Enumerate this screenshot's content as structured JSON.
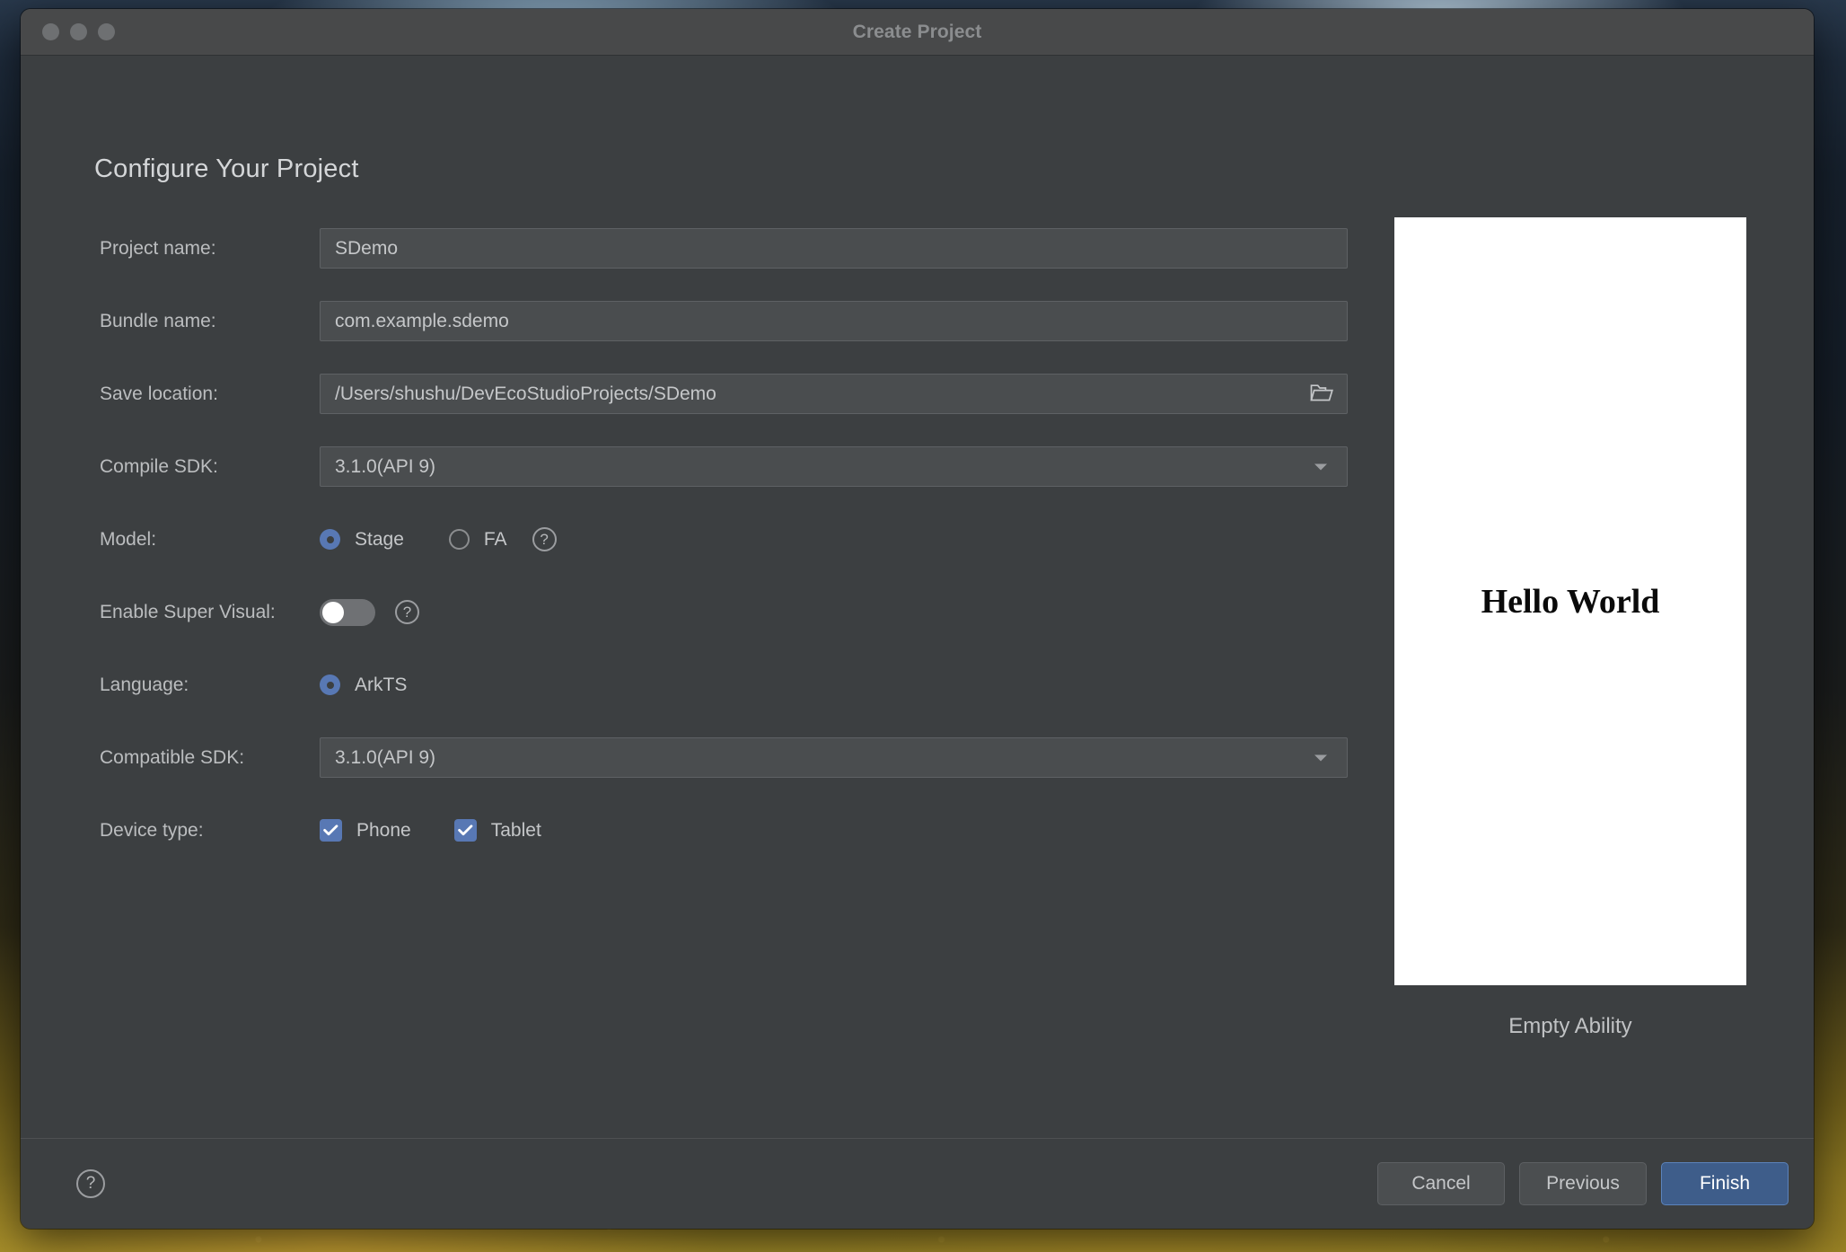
{
  "window": {
    "title": "Create Project",
    "traffic_lights": [
      "close-button",
      "minimize-button",
      "maximize-button"
    ]
  },
  "heading": "Configure Your Project",
  "form": {
    "fields": [
      {
        "type": "text",
        "name": "project-name",
        "label": "Project name:",
        "value": "SDemo",
        "placeholder": "Project name"
      },
      {
        "type": "text",
        "name": "bundle-name",
        "label": "Bundle name:",
        "value": "com.example.sdemo",
        "placeholder": "Bundle name"
      },
      {
        "type": "text-with-browse",
        "name": "save-location",
        "label": "Save location:",
        "value": "/Users/shushu/DevEcoStudioProjects/SDemo",
        "placeholder": "Save location",
        "button_icon": "folder-icon"
      },
      {
        "type": "combobox",
        "name": "compile-sdk",
        "label": "Compile SDK:",
        "value": "3.1.0(API 9)",
        "options": [
          "3.1.0(API 9)"
        ],
        "arrow_icon": "chevron-down-icon"
      },
      {
        "type": "radio",
        "name": "model",
        "label": "Model:",
        "options": [
          {
            "label": "Stage",
            "selected": true
          },
          {
            "label": "FA",
            "selected": false
          }
        ],
        "help_icon": "help-circle-icon",
        "help_label": "?"
      },
      {
        "type": "toggle",
        "name": "enable-super-visual",
        "label": "Enable Super Visual:",
        "checked": false,
        "help_icon": "help-circle-icon",
        "help_label": "?"
      },
      {
        "type": "radio",
        "name": "language",
        "label": "Language:",
        "options": [
          {
            "label": "ArkTS",
            "selected": true
          }
        ]
      },
      {
        "type": "combobox",
        "name": "compatible-sdk",
        "label": "Compatible SDK:",
        "value": "3.1.0(API 9)",
        "options": [
          "3.1.0(API 9)"
        ],
        "arrow_icon": "chevron-down-icon"
      },
      {
        "type": "checkbox",
        "name": "device-type",
        "label": "Device type:",
        "options": [
          {
            "label": "Phone",
            "checked": true
          },
          {
            "label": "Tablet",
            "checked": true
          }
        ]
      }
    ]
  },
  "preview": {
    "screen_text": "Hello World",
    "caption": "Empty Ability"
  },
  "footer": {
    "help_icon": "help-circle-icon",
    "help_label": "?",
    "buttons": [
      {
        "label": "Cancel",
        "style": "secondary"
      },
      {
        "label": "Previous",
        "style": "secondary"
      },
      {
        "label": "Finish",
        "style": "primary"
      }
    ]
  },
  "colors": {
    "window_bg": "#3c3f41",
    "titlebar_bg": "#48494a",
    "field_bg": "#4a4d4f",
    "field_border": "#5e6164",
    "accent_blue": "#5878b4",
    "primary_button_bg": "#3e5d8a",
    "primary_button_border": "#5b83bb",
    "text_primary": "#c5c7c9",
    "text_muted": "#8b8d8f"
  }
}
